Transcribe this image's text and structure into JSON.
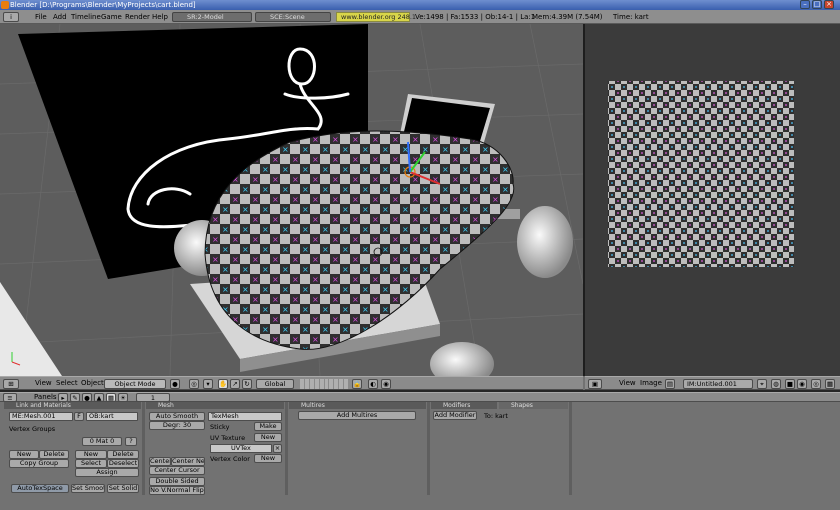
{
  "titlebar": {
    "text": "Blender [D:\\Programs\\Blender\\MyProjects\\cart.blend]"
  },
  "menubar": {
    "menus": [
      "File",
      "Add",
      "Timeline",
      "Game",
      "Render",
      "Help"
    ],
    "screen": "SR:2-Model",
    "scene": "SCE:Scene",
    "url": "www.blender.org 248.1",
    "stats": "Ve:1498 | Fa:1533 | Ob:14-1 | La:1",
    "mem": "Mem:4.39M (7.54M)",
    "time": "Time: kart"
  },
  "viewport_header": {
    "menus": [
      "View",
      "Select",
      "Object"
    ],
    "mode": "Object Mode",
    "orientation": "Global"
  },
  "image_header": {
    "menus": [
      "View",
      "Image"
    ],
    "image_name": "IM:Untitled.001"
  },
  "buttons_header": {
    "panels_label": "Panels",
    "page": "1"
  },
  "panels": {
    "link": {
      "title": "Link and Materials",
      "mesh_name": "ME:Mesh.001",
      "f_label": "F",
      "ob_name": "OB:kart",
      "vertex_groups": "Vertex Groups",
      "mat_slot": "0 Mat 0",
      "question": "?",
      "new1": "New",
      "delete1": "Delete",
      "copy_group": "Copy Group",
      "new2": "New",
      "delete2": "Delete",
      "select": "Select",
      "deselect": "Deselect",
      "assign": "Assign",
      "autotex": "AutoTexSpace",
      "set_smooth": "Set Smooth",
      "set_solid": "Set Solid"
    },
    "mesh": {
      "title": "Mesh",
      "auto_smooth": "Auto Smooth",
      "degr": "Degr: 30",
      "center": "Center",
      "center_new": "Center New",
      "center_cursor": "Center Cursor",
      "double_sided": "Double Sided",
      "no_v_normal_flip": "No V.Normal Flip",
      "texmesh": "TexMesh",
      "sticky": "Sticky",
      "make": "Make",
      "uv_texture": "UV Texture",
      "new_uv": "New",
      "uvtex": "UVTex",
      "vertex_color": "Vertex Color",
      "new_vc": "New"
    },
    "multires": {
      "title": "Multires",
      "add_multires": "Add Multires"
    },
    "modifiers": {
      "title": "Modifiers",
      "tab2": "Shapes",
      "add_modifier": "Add Modifier",
      "to": "To: kart"
    }
  },
  "colors": {
    "checker_dark": "#2f2f2f",
    "checker_light": "#bdbdbd",
    "accent": "#e87d0d"
  }
}
